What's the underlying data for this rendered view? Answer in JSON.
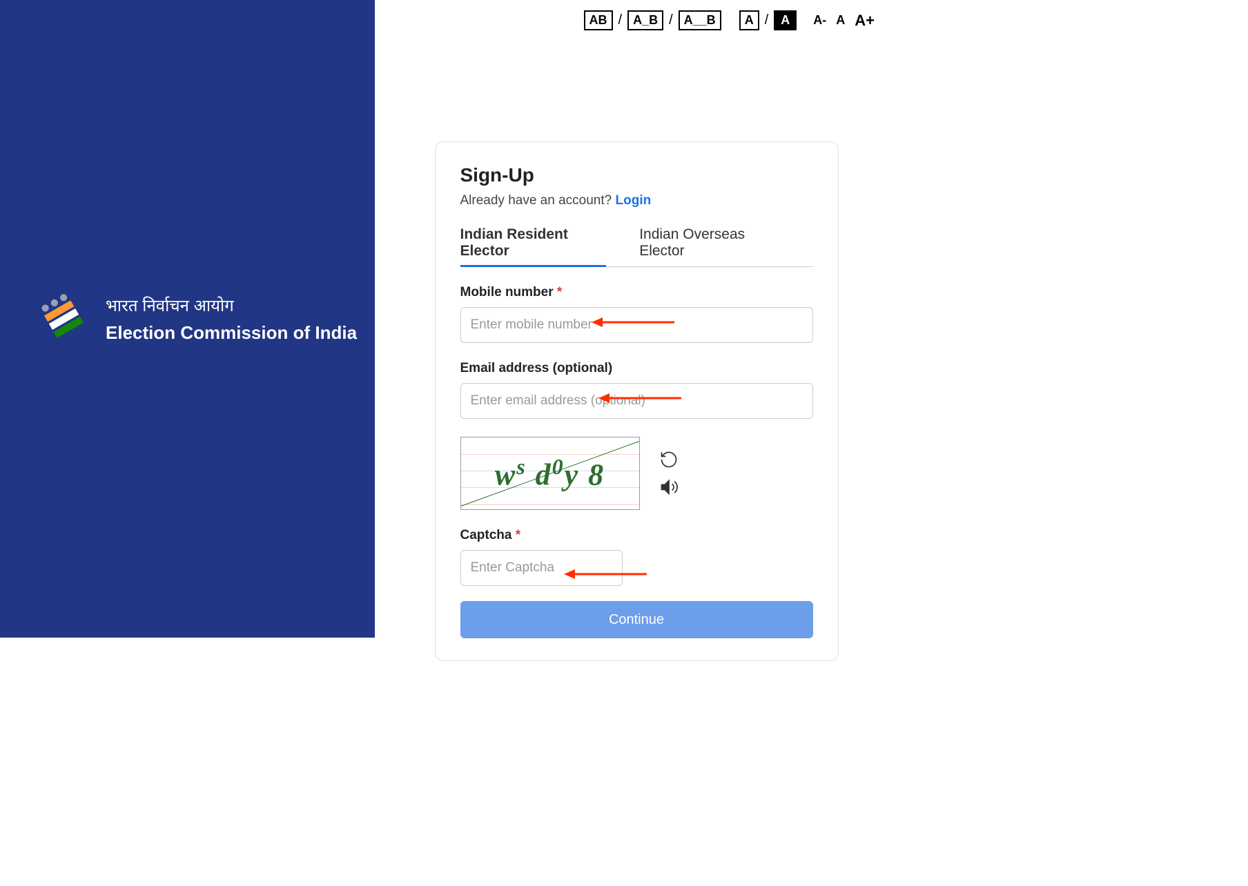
{
  "branding": {
    "hindi": "भारत निर्वाचन आयोग",
    "english": "Election Commission of India"
  },
  "accessibility": {
    "spacing_normal": "AB",
    "spacing_medium": "A_B",
    "spacing_wide": "A__B",
    "contrast_normal": "A",
    "contrast_high": "A",
    "font_small": "A-",
    "font_normal": "A",
    "font_large": "A+"
  },
  "card": {
    "title": "Sign-Up",
    "subtitle": "Already have an account? ",
    "login_text": "Login",
    "tabs": {
      "resident": "Indian Resident Elector",
      "overseas": "Indian Overseas Elector"
    },
    "fields": {
      "mobile_label": "Mobile number ",
      "mobile_placeholder": "Enter mobile number",
      "email_label": "Email address (optional)",
      "email_placeholder": "Enter email address (optional)",
      "captcha_label": "Captcha ",
      "captcha_placeholder": "Enter Captcha",
      "captcha_image_text": "wˢ d⁰y 8"
    },
    "continue_button": "Continue"
  },
  "annotations": {
    "arrow_color": "#ff2e00"
  }
}
